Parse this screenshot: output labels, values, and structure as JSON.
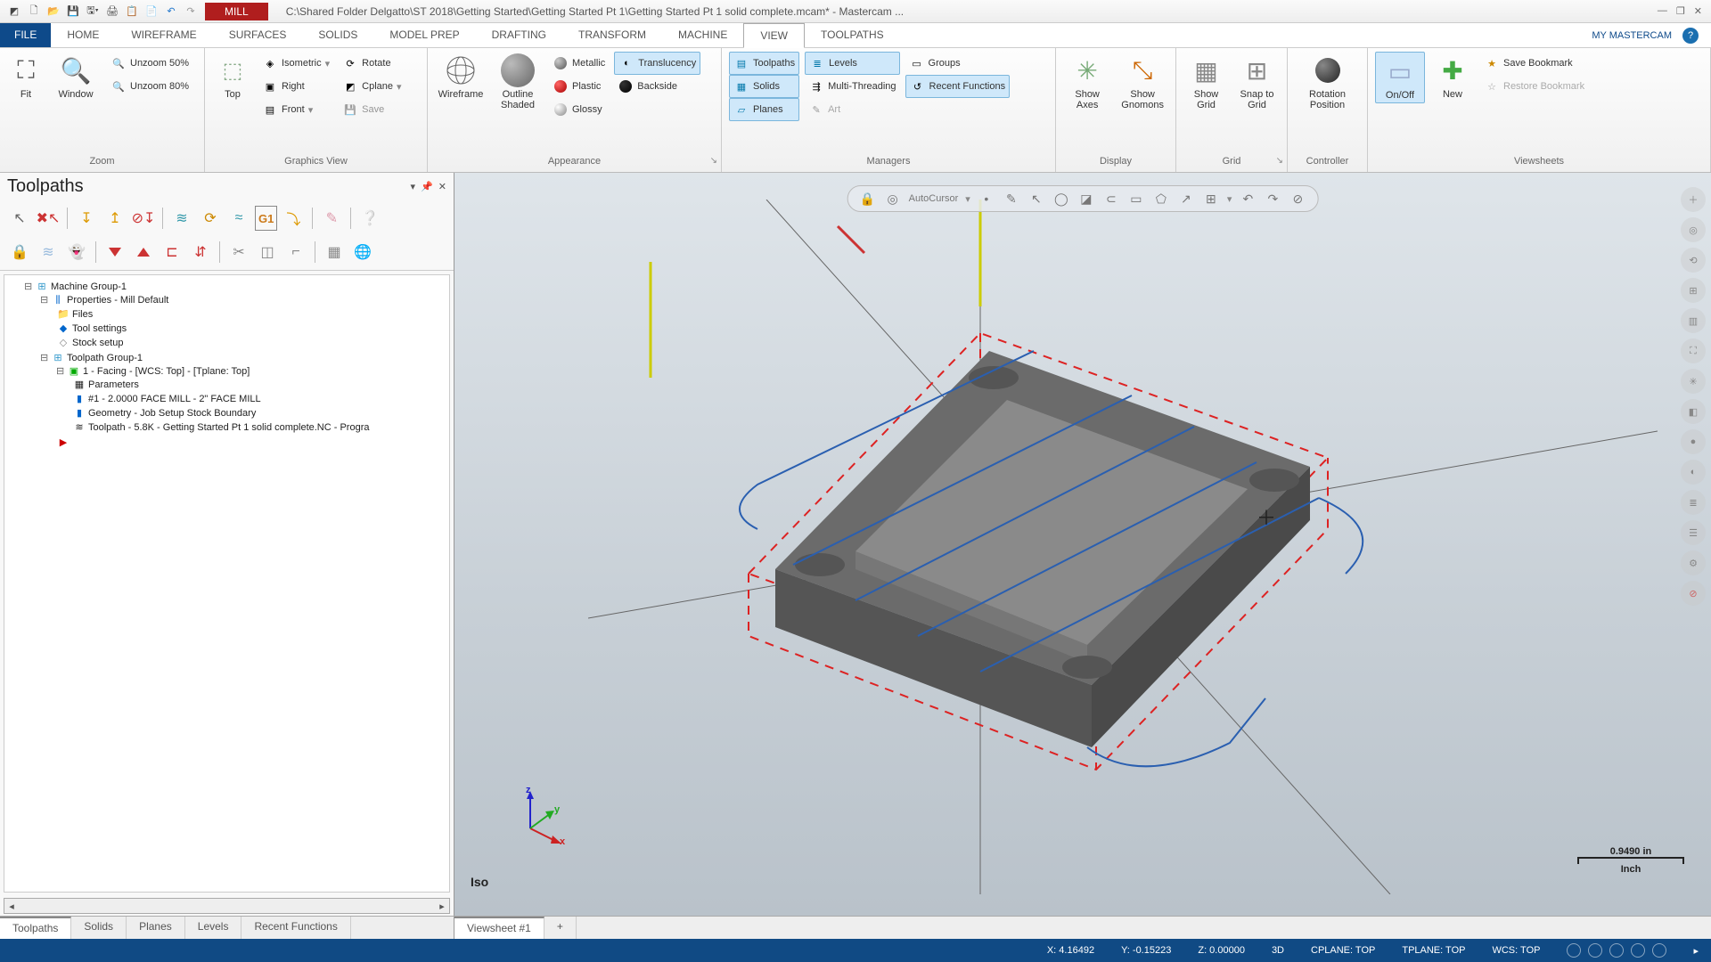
{
  "title": {
    "context_tab": "MILL",
    "path": "C:\\Shared Folder Delgatto\\ST 2018\\Getting Started\\Getting Started Pt 1\\Getting Started Pt 1 solid complete.mcam* - Mastercam ..."
  },
  "menu": {
    "file": "FILE",
    "tabs": [
      "HOME",
      "WIREFRAME",
      "SURFACES",
      "SOLIDS",
      "MODEL PREP",
      "DRAFTING",
      "TRANSFORM",
      "MACHINE",
      "VIEW",
      "TOOLPATHS"
    ],
    "active": "VIEW",
    "my": "MY MASTERCAM"
  },
  "ribbon": {
    "zoom": {
      "fit": "Fit",
      "window": "Window",
      "unzoom50": "Unzoom 50%",
      "unzoom80": "Unzoom 80%",
      "label": "Zoom"
    },
    "graphics": {
      "top": "Top",
      "iso": "Isometric",
      "right": "Right",
      "front": "Front",
      "rotate": "Rotate",
      "cplane": "Cplane",
      "save": "Save",
      "label": "Graphics View"
    },
    "appearance": {
      "wireframe": "Wireframe",
      "outline": "Outline Shaded",
      "metallic": "Metallic",
      "translucency": "Translucency",
      "plastic": "Plastic",
      "backside": "Backside",
      "glossy": "Glossy",
      "label": "Appearance"
    },
    "managers": {
      "toolpaths": "Toolpaths",
      "solids": "Solids",
      "planes": "Planes",
      "levels": "Levels",
      "multi": "Multi-Threading",
      "recent": "Recent Functions",
      "groups": "Groups",
      "art": "Art",
      "label": "Managers"
    },
    "display": {
      "axes": "Show Axes",
      "gnomons": "Show Gnomons",
      "label": "Display"
    },
    "grid": {
      "showgrid": "Show Grid",
      "snap": "Snap to Grid",
      "label": "Grid"
    },
    "controller": {
      "rotpos": "Rotation Position",
      "label": "Controller"
    },
    "viewsheets": {
      "onoff": "On/Off",
      "new": "New",
      "savebm": "Save Bookmark",
      "restore": "Restore Bookmark",
      "label": "Viewsheets"
    }
  },
  "panel": {
    "title": "Toolpaths",
    "tree": {
      "machine_group": "Machine Group-1",
      "properties": "Properties - Mill Default",
      "files": "Files",
      "toolsettings": "Tool settings",
      "stock": "Stock setup",
      "tpgroup": "Toolpath Group-1",
      "op1": "1 - Facing - [WCS: Top] - [Tplane: Top]",
      "params": "Parameters",
      "tool": "#1 - 2.0000 FACE MILL - 2\"  FACE MILL",
      "geom": "Geometry - Job Setup Stock Boundary",
      "tp": "Toolpath - 5.8K - Getting Started Pt 1 solid complete.NC - Progra"
    }
  },
  "floating_toolbar": {
    "autocursor": "AutoCursor"
  },
  "viewport": {
    "iso": "Iso",
    "scale_value": "0.9490 in",
    "scale_unit": "Inch",
    "gnomon": {
      "x": "x",
      "y": "y",
      "z": "z"
    }
  },
  "bottom_tabs_left": [
    "Toolpaths",
    "Solids",
    "Planes",
    "Levels",
    "Recent Functions"
  ],
  "bottom_tabs_right": [
    "Viewsheet #1",
    "+"
  ],
  "status": {
    "x": "X: 4.16492",
    "y": "Y: -0.15223",
    "z": "Z: 0.00000",
    "mode": "3D",
    "cplane": "CPLANE: TOP",
    "tplane": "TPLANE: TOP",
    "wcs": "WCS: TOP"
  }
}
